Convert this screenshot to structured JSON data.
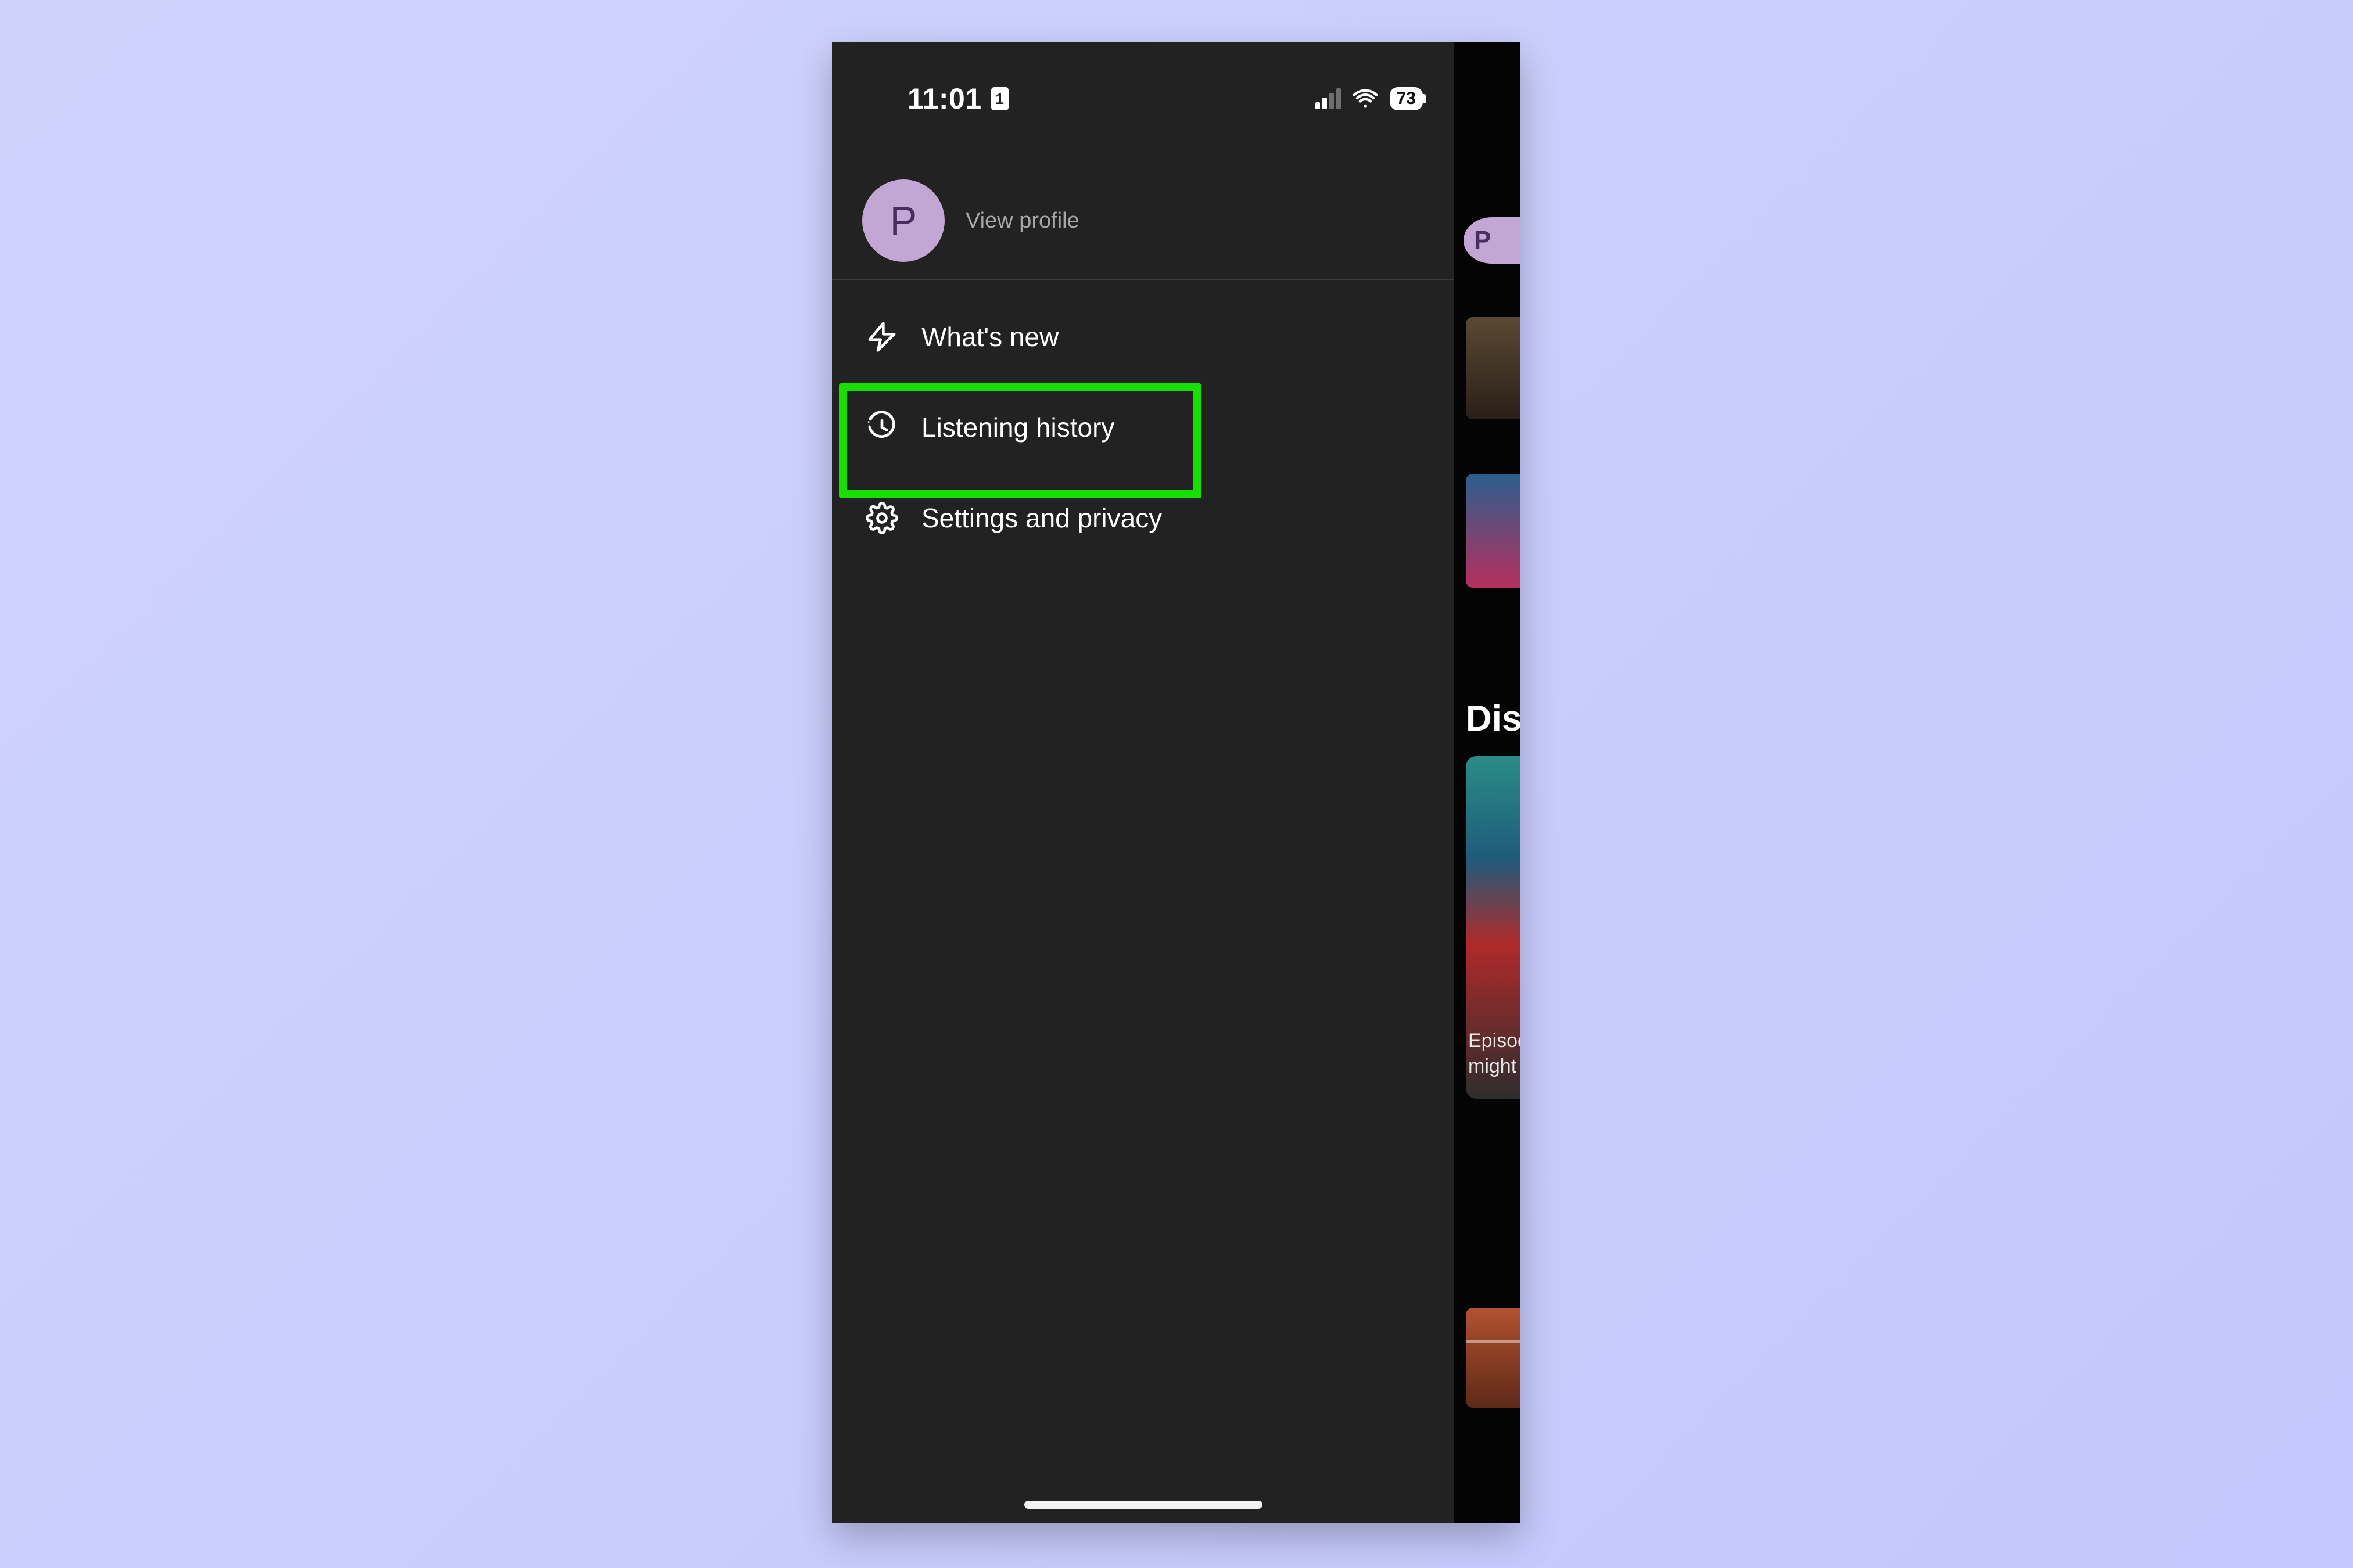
{
  "statusbar": {
    "time": "11:01",
    "sim_badge": "1",
    "battery_percent": "73"
  },
  "profile": {
    "avatar_letter": "P",
    "view_profile_label": "View profile"
  },
  "menu": {
    "whats_new_label": "What's new",
    "listening_history_label": "Listening history",
    "settings_label": "Settings and privacy"
  },
  "behind": {
    "section_title": "Discover",
    "card_caption_1": "Episodes you",
    "card_caption_2": "might like",
    "avatar_letter": "P"
  }
}
